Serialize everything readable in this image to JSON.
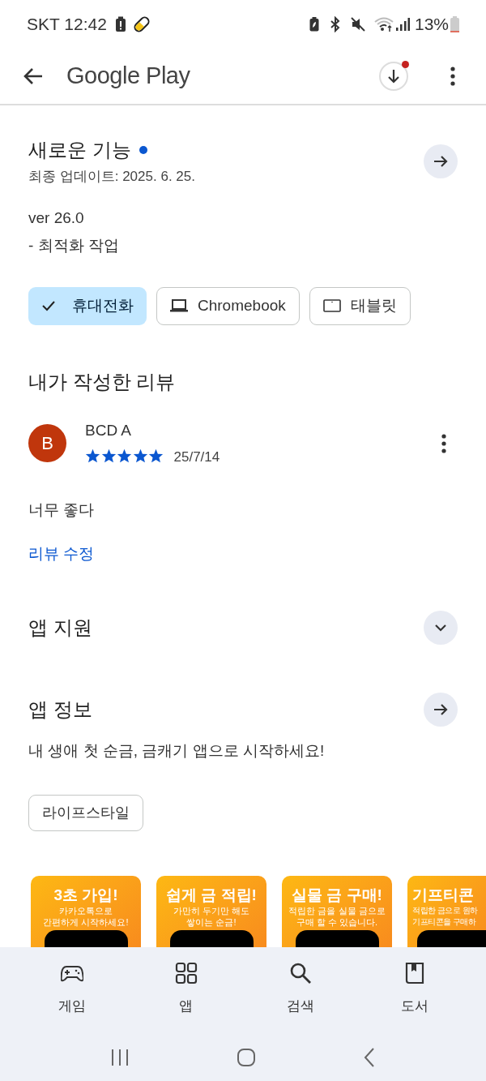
{
  "status_bar": {
    "carrier_time": "SKT 12:42",
    "battery": "13%"
  },
  "app_bar": {
    "title": "Google Play",
    "download_badge": true
  },
  "whats_new": {
    "title": "새로운 기능",
    "new_dot": true,
    "updated": "최종 업데이트: 2025. 6. 25.",
    "version": "ver 26.0",
    "notes": "- 최적화 작업"
  },
  "devices": [
    {
      "label": "휴대전화",
      "selected": true
    },
    {
      "label": "Chromebook",
      "kind": "laptop",
      "selected": false
    },
    {
      "label": "태블릿",
      "kind": "tablet",
      "selected": false
    }
  ],
  "my_review": {
    "title": "내가 작성한 리뷰",
    "avatar": "B",
    "author": "BCD A",
    "stars": 5,
    "date": "25/7/14",
    "text": "너무 좋다",
    "edit_link": "리뷰 수정"
  },
  "app_support": {
    "title": "앱 지원",
    "expanded": false
  },
  "app_info": {
    "title": "앱 정보",
    "description": "내 생애 첫 순금, 금캐기 앱으로 시작하세요!",
    "category": "라이프스타일"
  },
  "screenshots": [
    {
      "title": "3초 가입!",
      "lines": [
        "카카오톡으로",
        "간편하게 시작하세요!"
      ]
    },
    {
      "title": "쉽게 금 적립!",
      "lines": [
        "가만히 두기만 해도",
        "쌓이는 순금!"
      ]
    },
    {
      "title": "실물 금 구매!",
      "lines": [
        "적립한 금을 실물 금으로",
        "구매 할 수 있습니다."
      ]
    },
    {
      "title": "기프티콘",
      "lines": [
        "적립한 금으로 원하",
        "기프티콘을 구매하"
      ]
    }
  ],
  "bottom_nav": [
    {
      "label": "게임",
      "kind": "games",
      "selected": false
    },
    {
      "label": "앱",
      "kind": "apps",
      "selected": false
    },
    {
      "label": "검색",
      "kind": "search",
      "selected": false
    },
    {
      "label": "도서",
      "kind": "books",
      "selected": false
    }
  ]
}
